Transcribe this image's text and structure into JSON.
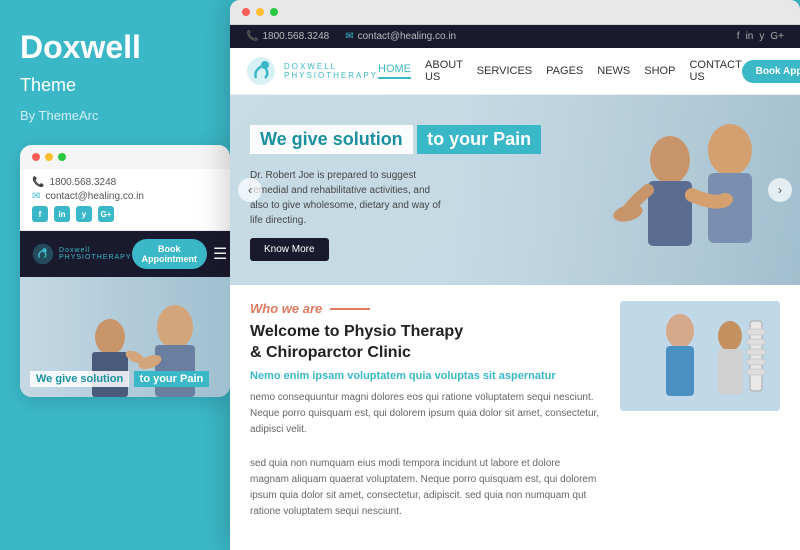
{
  "left": {
    "brand": "Doxwell",
    "theme": "Theme",
    "by": "By ThemeArc",
    "dots": [
      "red",
      "yellow",
      "green"
    ],
    "phone": "1800.568.3248",
    "email": "contact@healing.co.in",
    "social": [
      "f",
      "in",
      "y",
      "G+"
    ],
    "logo": "Doxwell",
    "logo_sub": "PHYSIOTHERAPY",
    "book_btn": "Book Appointment",
    "hero_text1": "We give solution",
    "hero_text2": "to your Pain"
  },
  "right": {
    "window_dots": [
      "red",
      "yellow",
      "green"
    ],
    "topbar": {
      "phone": "1800.568.3248",
      "email": "contact@healing.co.in",
      "social": [
        "f",
        "in",
        "y",
        "G+"
      ]
    },
    "nav": {
      "logo": "Doxwell",
      "logo_sub": "PHYSIOTHERAPY",
      "links": [
        "HOME",
        "ABOUT US",
        "SERVICES",
        "PAGES",
        "NEWS",
        "SHOP",
        "CONTACT US"
      ],
      "active": "HOME",
      "book_btn": "Book Appointment"
    },
    "hero": {
      "text1": "We give solution",
      "text2": "to your Pain",
      "desc": "Dr. Robert Joe is prepared to suggest remedial and rehabilitative activities, and also to give wholesome, dietary and way of life directing.",
      "know_more": "Know More"
    },
    "about": {
      "tag": "Who we are",
      "title": "Welcome to Physio Therapy\n& Chiroparctor Clinic",
      "subtitle": "Nemo enim ipsam voluptatem quia voluptas sit aspernatur",
      "text1": "nemo consequuntur magni dolores eos qui ratione voluptatem sequi nesciunt. Neque porro quisquam est, qui dolorem ipsum quia dolor sit amet, consectetur, adipisci velit.",
      "text2": "sed quia non numquam eius modi tempora incidunt ut labore et dolore magnam aliquam quaerat voluptatem. Neque porro quisquam est, qui dolorem ipsum quia dolor sit amet, consectetur, adipiscit. sed quia non numquam qut ratione voluptatem sequi nesciunt."
    }
  }
}
